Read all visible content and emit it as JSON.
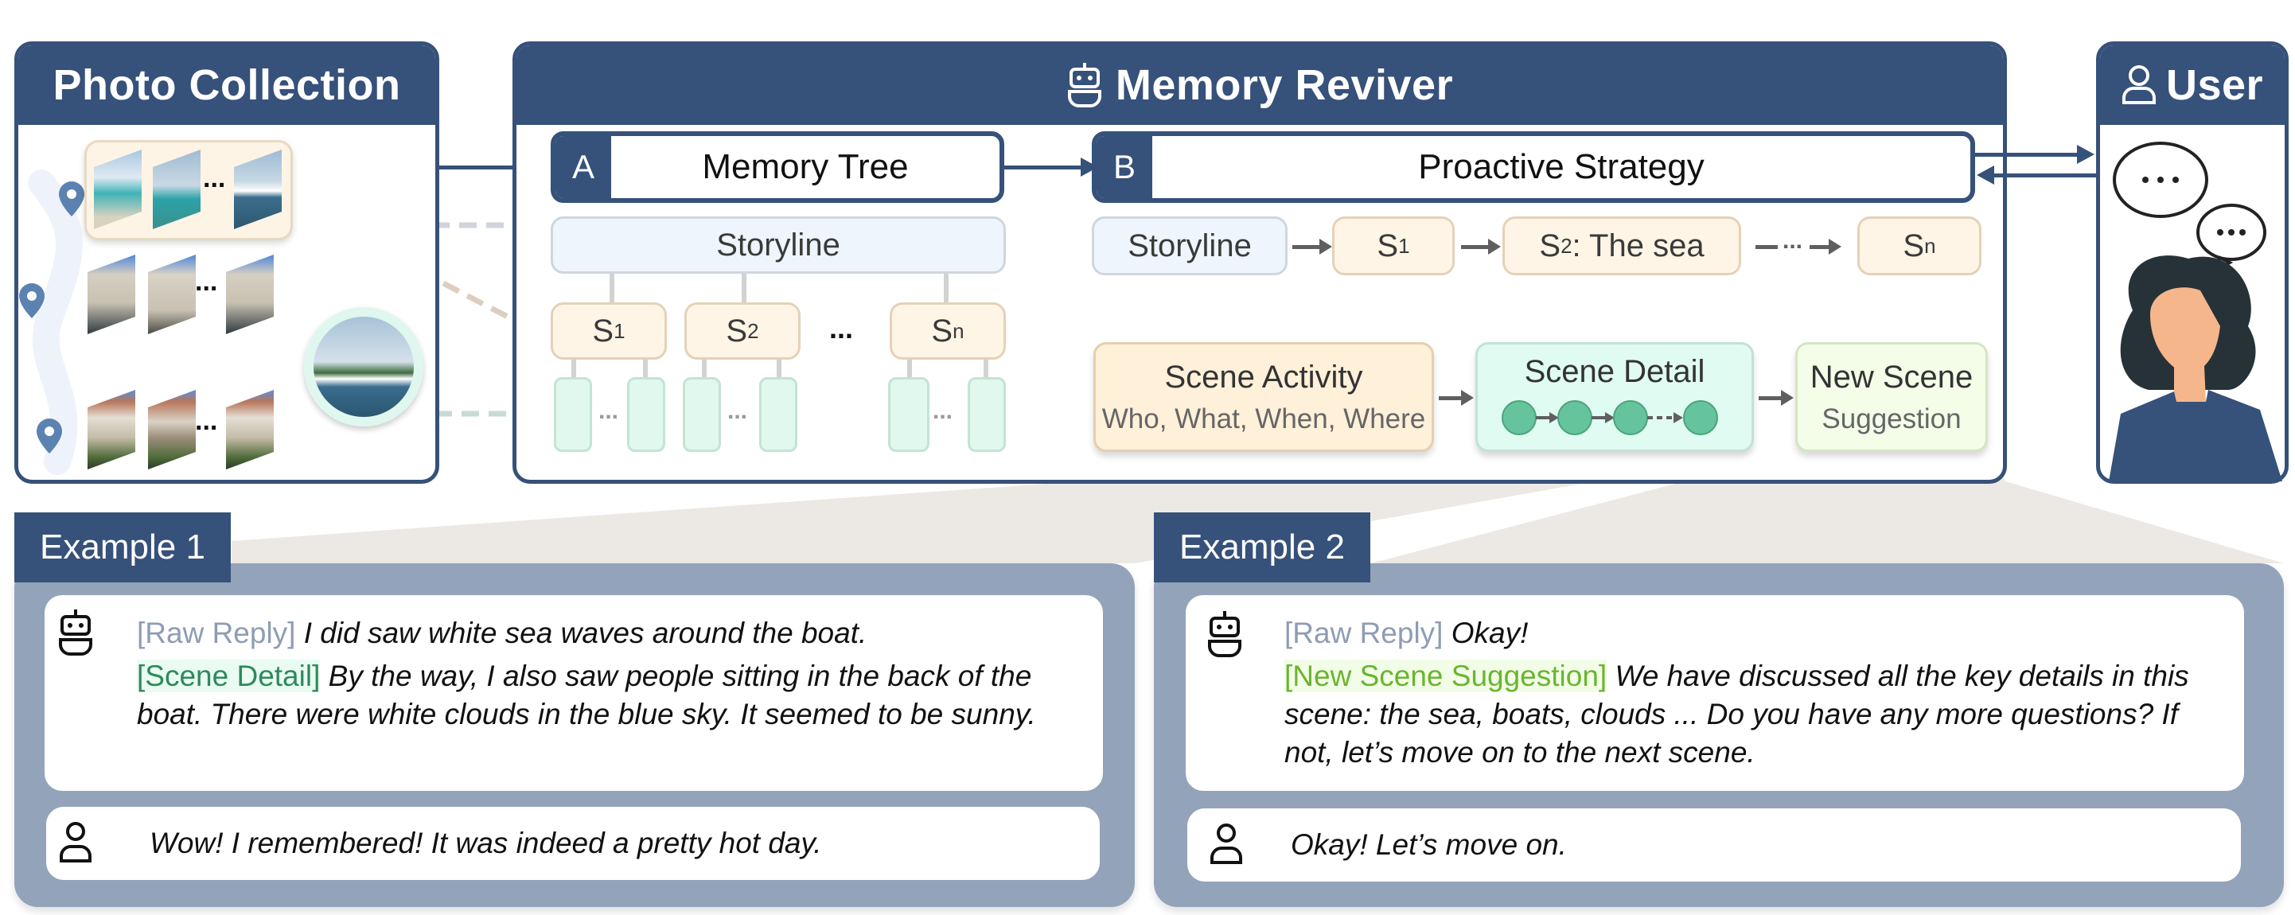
{
  "photo_collection": {
    "title": "Photo Collection",
    "ellipsis": "..."
  },
  "memory_reviver": {
    "title": "Memory Reviver",
    "icon": "robot-icon",
    "memory_tree": {
      "letter": "A",
      "title": "Memory Tree",
      "storyline": "Storyline",
      "scenes": [
        {
          "base": "S",
          "sub": "1"
        },
        {
          "base": "S",
          "sub": "2"
        },
        {
          "base": "S",
          "sub": "n"
        }
      ],
      "scene_ellipsis": "...",
      "leaf_ellipsis": "..."
    },
    "proactive_strategy": {
      "letter": "B",
      "title": "Proactive Strategy",
      "flow": {
        "storyline": "Storyline",
        "s1": {
          "base": "S",
          "sub": "1"
        },
        "s2": {
          "base": "S",
          "sub": "2",
          "suffix": ": The sea"
        },
        "ellipsis": "...",
        "sn": {
          "base": "S",
          "sub": "n"
        }
      },
      "stages": {
        "scene_activity": {
          "title": "Scene Activity",
          "subtitle": "Who, What, When, Where"
        },
        "scene_detail": {
          "title": "Scene Detail"
        },
        "new_scene": {
          "title": "New Scene",
          "subtitle": "Suggestion"
        }
      }
    }
  },
  "user": {
    "title": "User",
    "icon": "user-icon",
    "speech": "..."
  },
  "examples": [
    {
      "title": "Example 1",
      "assistant": {
        "raw_tag": "[Raw Reply]",
        "raw_text": " I did saw white sea waves around the boat.",
        "strategy_tag": "[Scene Detail]",
        "strategy_text": " By the way, I also saw people sitting in the back of the boat. There were white clouds in the blue sky. It seemed to be sunny."
      },
      "user_reply": "Wow! I remembered! It was indeed a pretty hot day."
    },
    {
      "title": "Example 2",
      "assistant": {
        "raw_tag": "[Raw Reply]",
        "raw_text": "  Okay!",
        "strategy_tag": "[New Scene Suggestion]",
        "strategy_text": " We have discussed all the key details in this scene: the sea, boats, clouds ... Do you have any more questions? If not, let’s move on to the next scene."
      },
      "user_reply": "Okay! Let’s move on."
    }
  ],
  "colors": {
    "navy": "#36517a",
    "storyline_fill": "#eef5fd",
    "scene_fill": "#fff5e6",
    "leaf_fill": "#e0f8ee",
    "detail_green": "#2e8a5a",
    "suggestion_green": "#6bb52e",
    "raw_gray": "#8e9cb4",
    "example_frame": "#93a3ba"
  }
}
